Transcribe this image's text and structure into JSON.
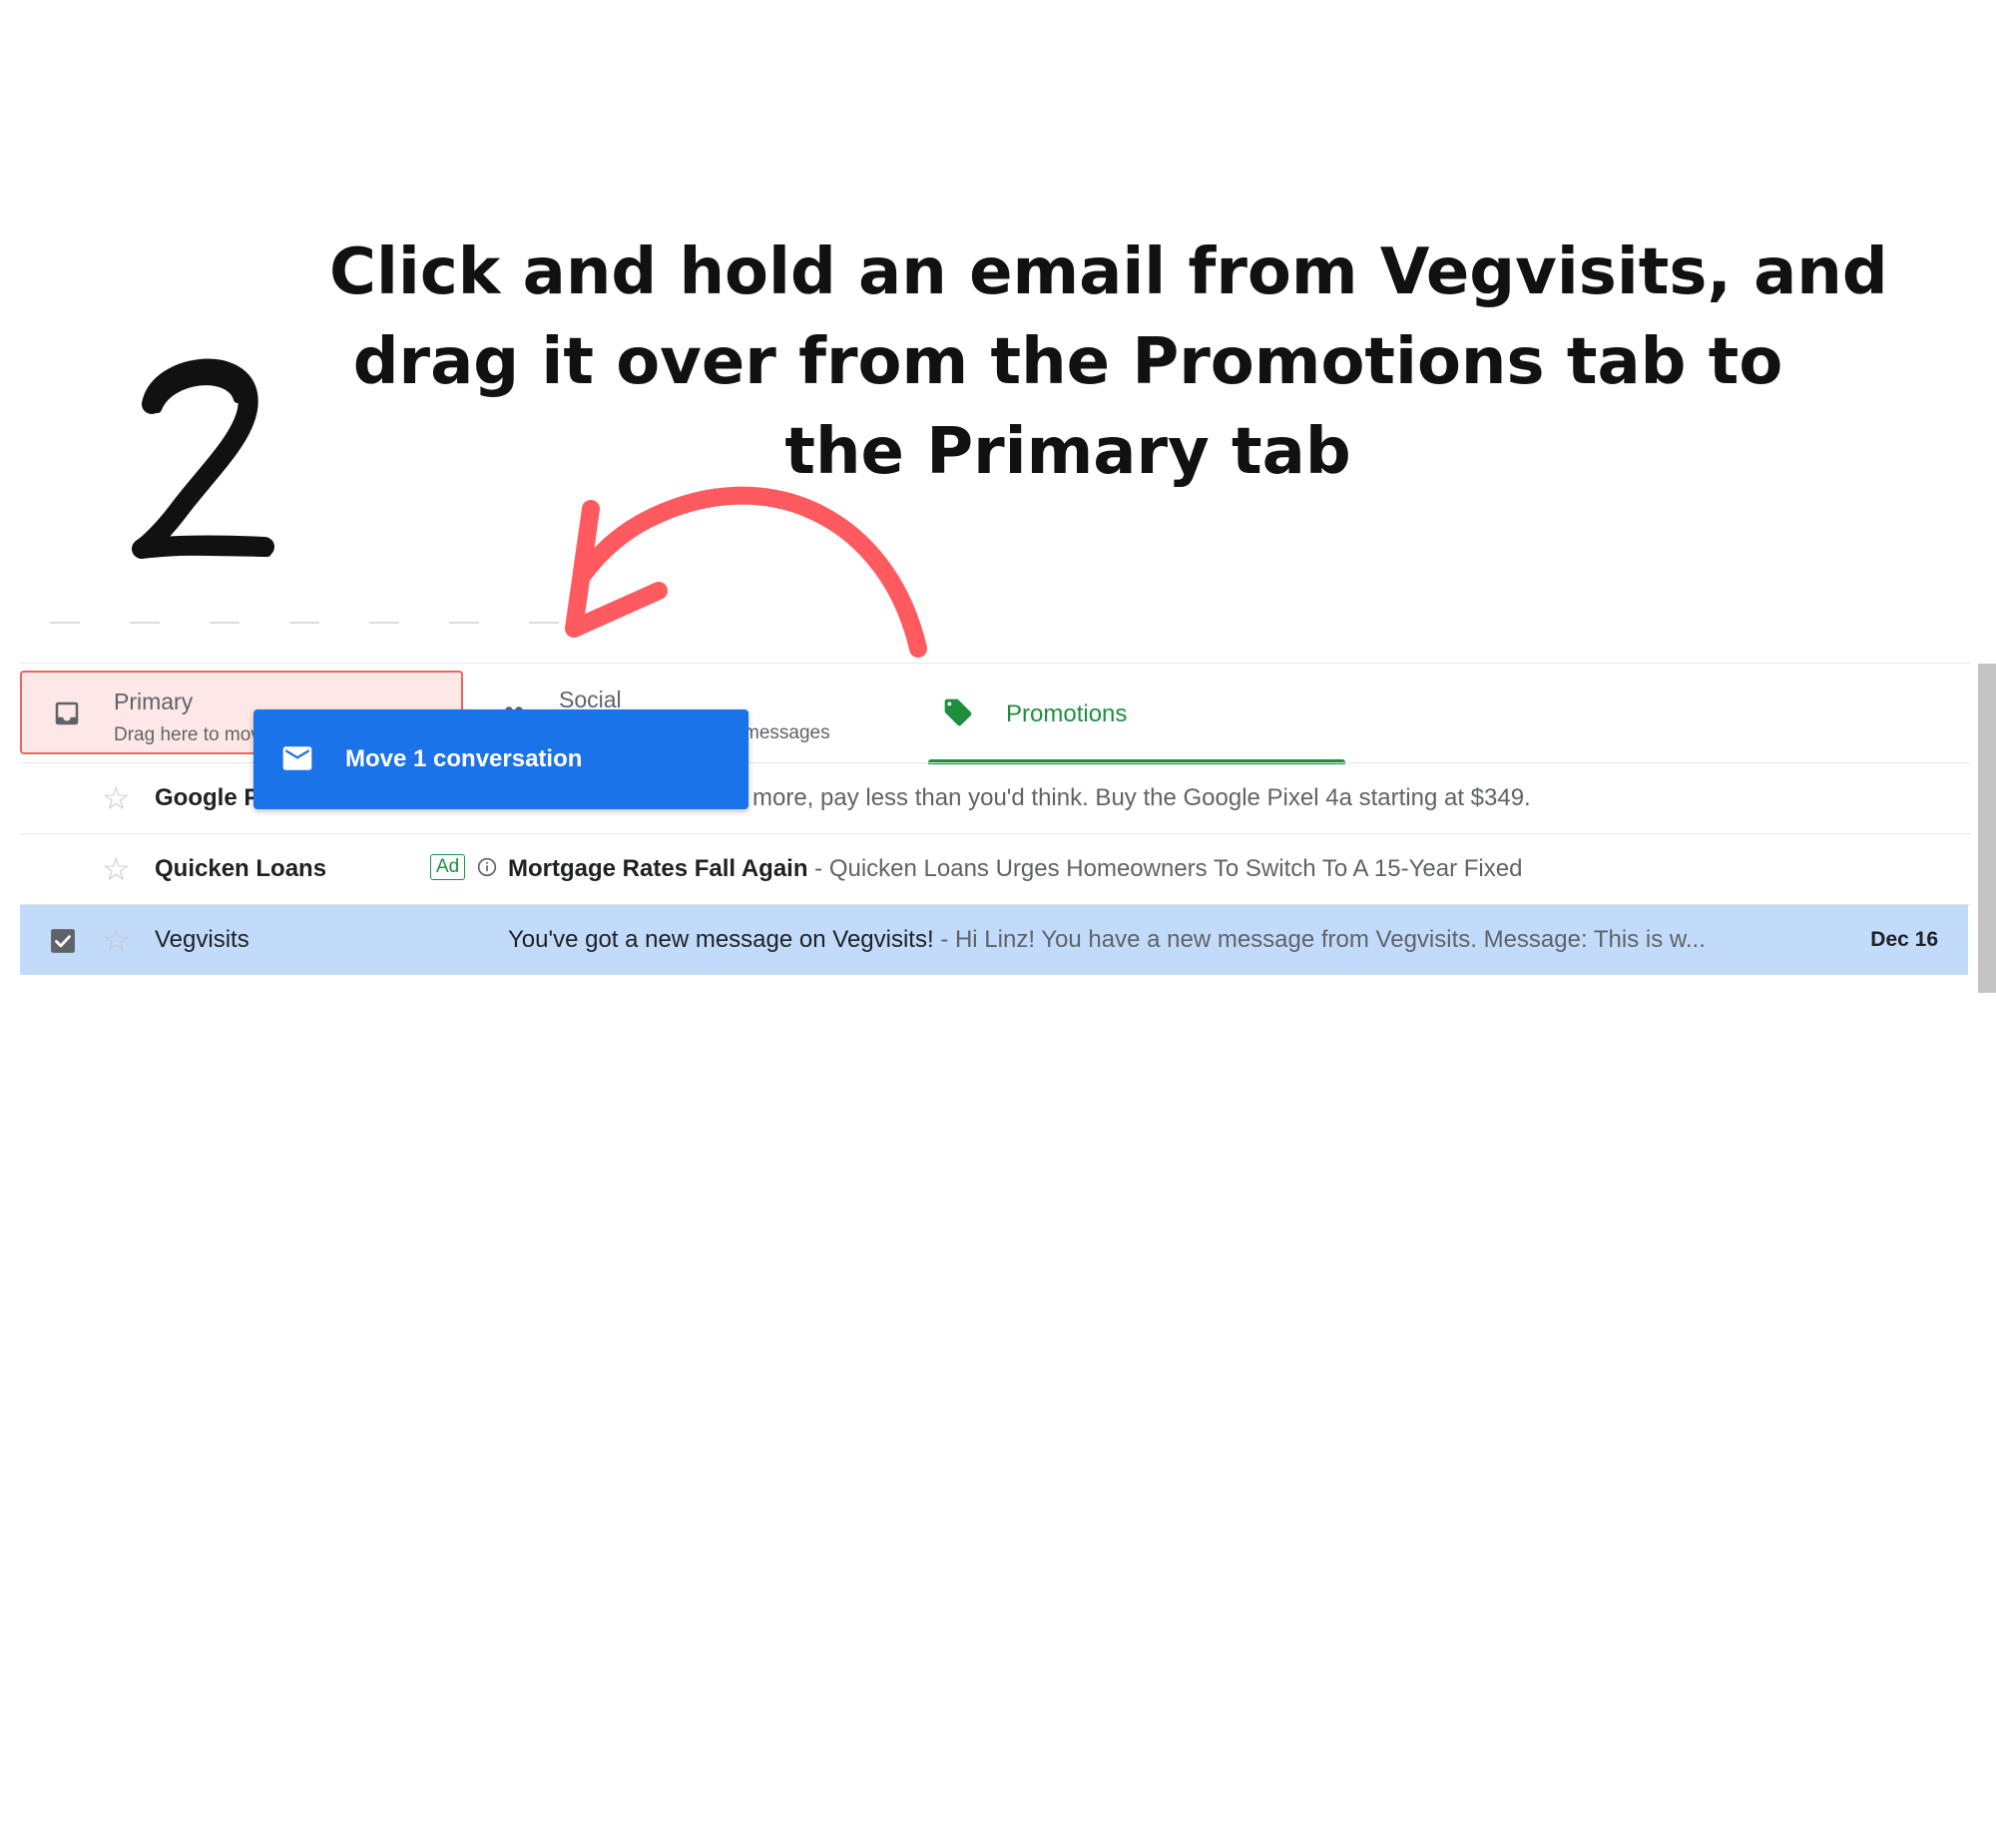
{
  "step_number": "2",
  "instruction": {
    "line1": "Click and hold an email from Vegvisits, and",
    "line2": "drag it over from the Promotions tab to",
    "line3": "the Primary tab"
  },
  "colors": {
    "arrow": "#ff5a5f",
    "primary_highlight": "#fde8e7",
    "promotions_green": "#1e8e3e",
    "drag_blue": "#1a73e8",
    "selected_row": "#c2dbfb"
  },
  "tabs": {
    "primary": {
      "title": "Primary",
      "subtitle": "Drag here to move",
      "icon": "inbox-icon"
    },
    "social": {
      "title": "Social",
      "subtitle": "messages",
      "icon": "people-icon"
    },
    "promotions": {
      "title": "Promotions",
      "icon": "tag-icon",
      "active": true
    }
  },
  "drag_chip": {
    "label": "Move 1 conversation",
    "icon": "mail-icon"
  },
  "emails": [
    {
      "sender": "Google P",
      "ad": true,
      "subject": "",
      "snippet": "more, pay less than you'd think. Buy the Google Pixel 4a starting at $349.",
      "date": "",
      "selected": false
    },
    {
      "sender": "Quicken Loans",
      "ad": true,
      "subject": "Mortgage Rates Fall Again",
      "snippet": " - Quicken Loans Urges Homeowners To Switch To A 15-Year Fixed",
      "date": "",
      "selected": false
    },
    {
      "sender": "Vegvisits",
      "ad": false,
      "subject": "You've got a new message on Vegvisits!",
      "snippet": " - Hi Linz! You have a new message from Vegvisits. Message: This is w...",
      "date": "Dec 16",
      "selected": true
    }
  ],
  "ad_label": "Ad"
}
